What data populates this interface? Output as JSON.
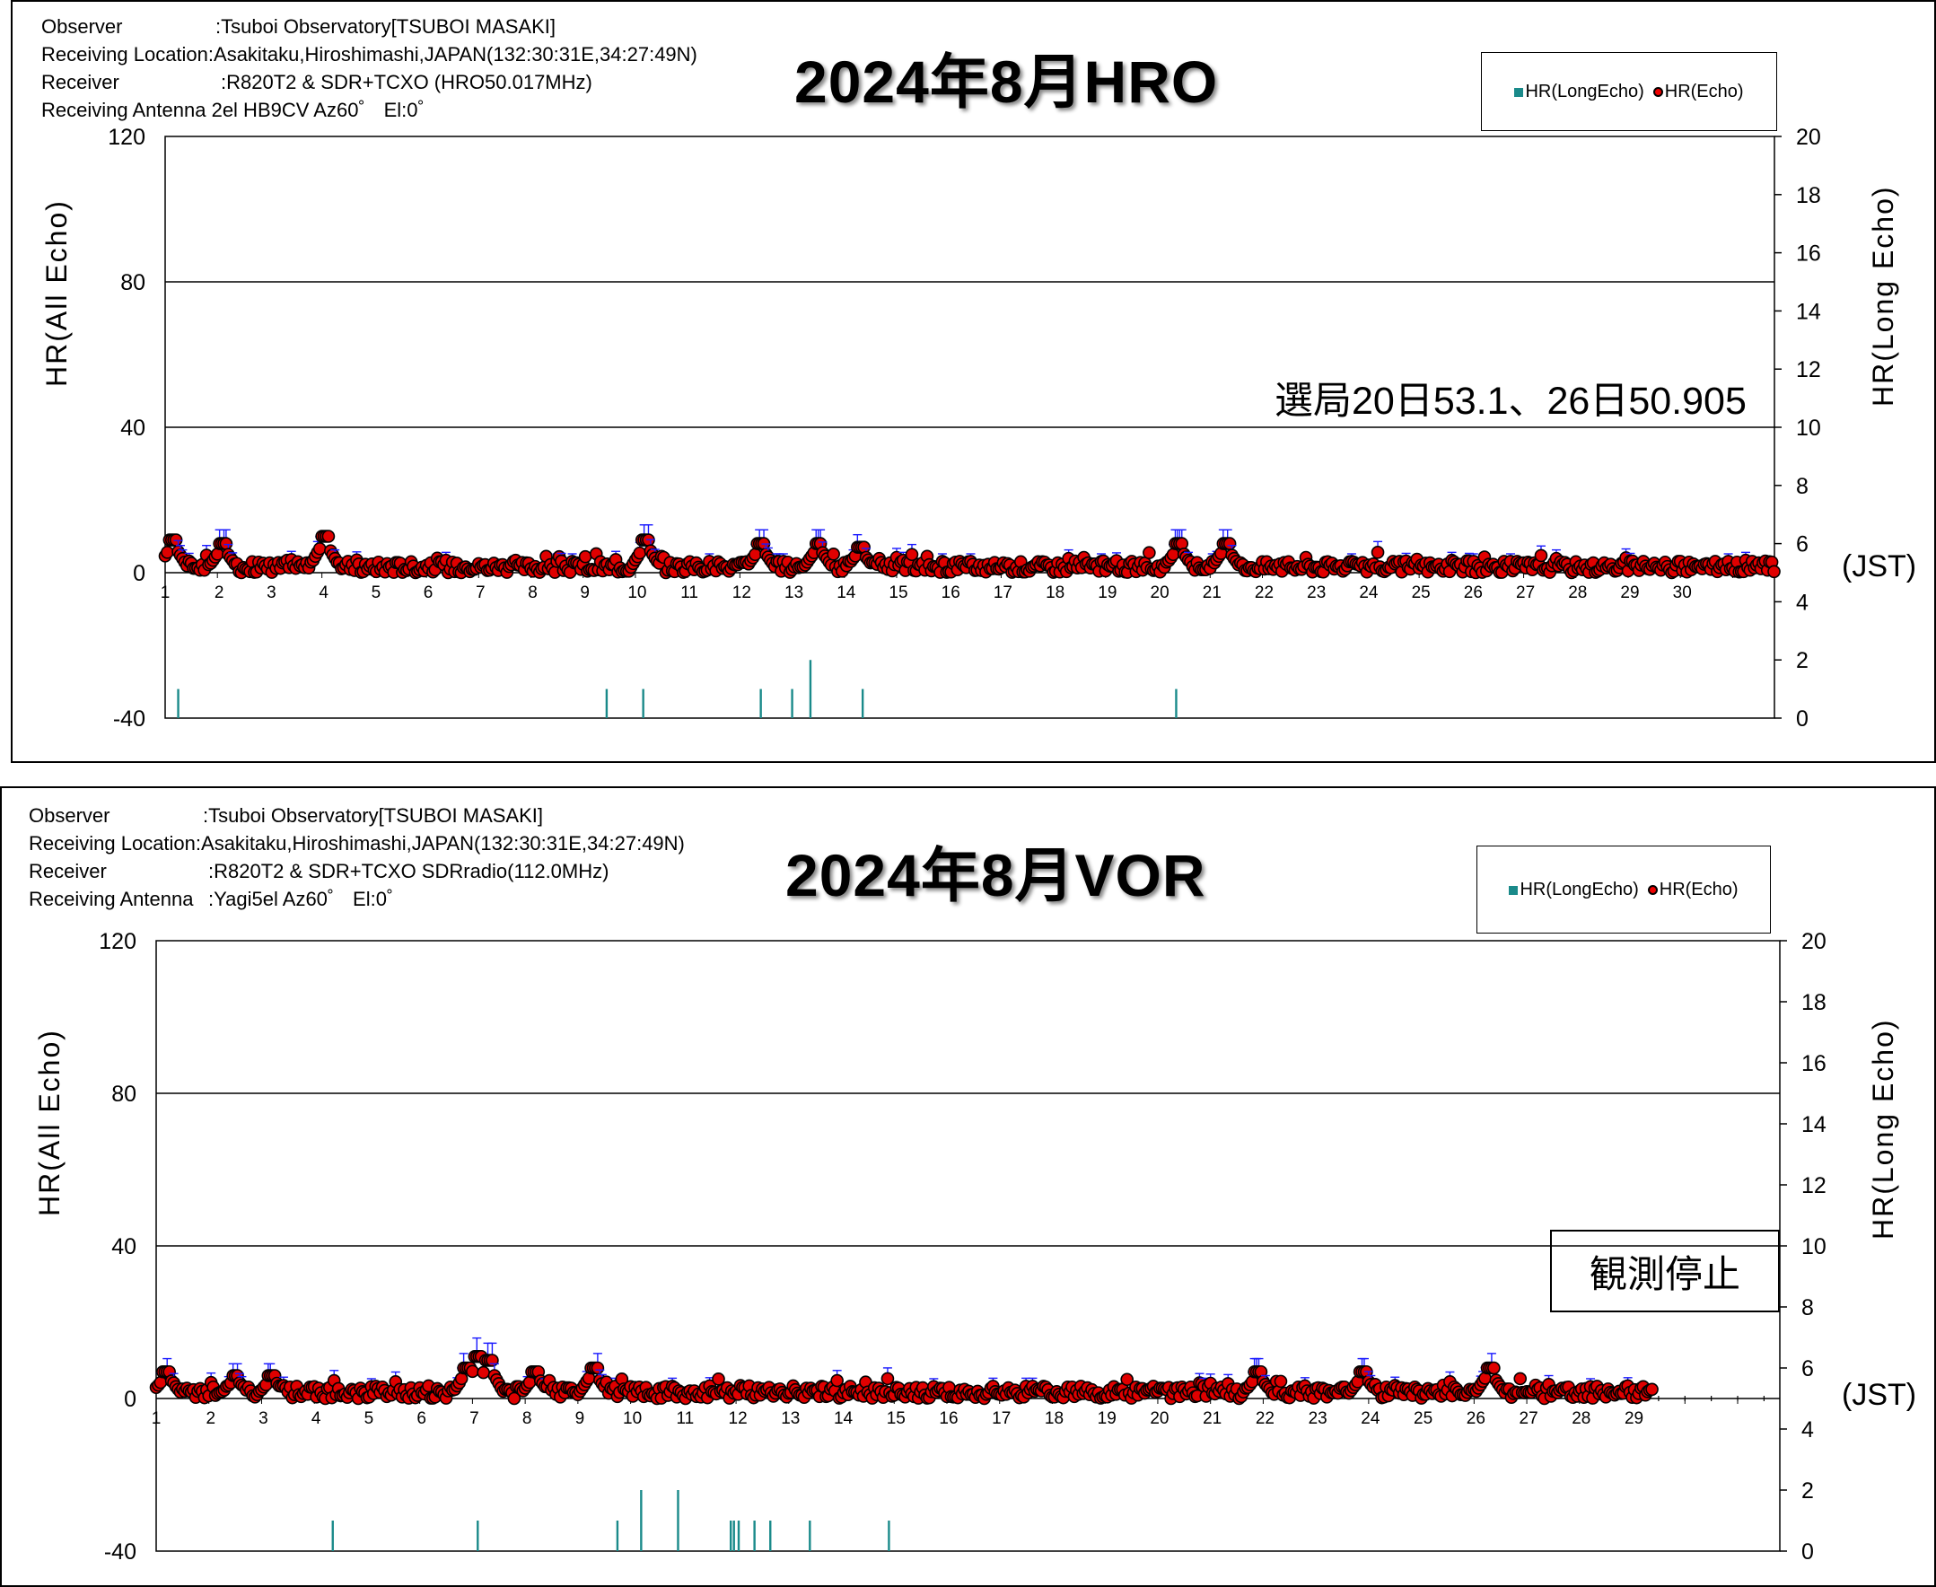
{
  "colors": {
    "echo_fill": "#e00000",
    "echo_edge": "#000000",
    "long_echo": "#1a8a8a",
    "error_bar": "#1a1aff"
  },
  "panels": [
    {
      "info": [
        {
          "k": "Observer",
          "v": ":Tsuboi Observatory[TSUBOI MASAKI]"
        },
        {
          "k": "Receiving Location",
          "v": ":Asakitaku,Hiroshimashi,JAPAN(132:30:31E,34:27:49N)"
        },
        {
          "k": "Receiver",
          "v": ":R820T2 & SDR+TCXO (HRO50.017MHz)"
        },
        {
          "k": "Receiving Antenna",
          "v": " 2el HB9CV Az60゜ El:0゜"
        }
      ],
      "title": "2024年8月HRO",
      "legend": {
        "long": "HR(LongEcho)",
        "echo": "HR(Echo)"
      },
      "ylabel_left": "HR(All Echo)",
      "ylabel_right": "HR(Long Echo)",
      "jst": "(JST)",
      "annotation": "選局20日53.1、26日50.905",
      "stop_label": ""
    },
    {
      "info": [
        {
          "k": "Observer",
          "v": ":Tsuboi Observatory[TSUBOI MASAKI]"
        },
        {
          "k": "Receiving Location",
          "v": ":Asakitaku,Hiroshimashi,JAPAN(132:30:31E,34:27:49N)"
        },
        {
          "k": "Receiver",
          "v": ":R820T2 & SDR+TCXO SDRradio(112.0MHz)"
        },
        {
          "k": "Receiving Antenna",
          "v": ":Yagi5el  Az60゜ El:0゜"
        }
      ],
      "title": "2024年8月VOR",
      "legend": {
        "long": "HR(LongEcho)",
        "echo": "HR(Echo)"
      },
      "ylabel_left": "HR(All Echo)",
      "ylabel_right": "HR(Long Echo)",
      "jst": "(JST)",
      "annotation": "",
      "stop_label": "観測停止"
    }
  ],
  "chart_data": [
    {
      "type": "scatter",
      "title": "2024年8月HRO",
      "x_unit": "day of August 2024 (JST), hourly",
      "x_ticks": [
        "1",
        "2",
        "3",
        "4",
        "5",
        "6",
        "7",
        "8",
        "9",
        "10",
        "11",
        "12",
        "13",
        "14",
        "15",
        "16",
        "17",
        "18",
        "19",
        "20",
        "21",
        "22",
        "23",
        "24",
        "25",
        "26",
        "27",
        "28",
        "29",
        "30"
      ],
      "xlim": [
        1,
        31.8
      ],
      "y_left": {
        "label": "HR(All Echo)",
        "lim": [
          -40,
          120
        ],
        "ticks": [
          -40,
          0,
          40,
          80,
          120
        ]
      },
      "y_right": {
        "label": "HR(Long Echo)",
        "lim": [
          0,
          20
        ],
        "ticks": [
          0,
          2,
          4,
          6,
          8,
          10,
          12,
          14,
          16,
          18,
          20
        ]
      },
      "grid": "horizontal at 40 and 80",
      "legend": "top-right",
      "series": [
        {
          "name": "HR(Echo)",
          "axis": "left",
          "typical_range": [
            0,
            6
          ],
          "peaks": [
            [
              1.15,
              9
            ],
            [
              2.1,
              8
            ],
            [
              4.05,
              10
            ],
            [
              10.2,
              9
            ],
            [
              12.4,
              8
            ],
            [
              13.5,
              8
            ],
            [
              14.3,
              7
            ],
            [
              20.4,
              8
            ],
            [
              21.3,
              8
            ]
          ],
          "end_day": 31.8
        },
        {
          "name": "HR(LongEcho)",
          "axis": "right",
          "points": [
            [
              1.25,
              1
            ],
            [
              9.45,
              1
            ],
            [
              10.15,
              1
            ],
            [
              12.4,
              1
            ],
            [
              13.0,
              1
            ],
            [
              13.35,
              2
            ],
            [
              14.35,
              1
            ],
            [
              20.35,
              1
            ]
          ]
        }
      ]
    },
    {
      "type": "scatter",
      "title": "2024年8月VOR",
      "x_unit": "day of August 2024 (JST), hourly",
      "x_ticks": [
        "1",
        "2",
        "3",
        "4",
        "5",
        "6",
        "7",
        "8",
        "9",
        "10",
        "11",
        "12",
        "13",
        "14",
        "15",
        "16",
        "17",
        "18",
        "19",
        "20",
        "21",
        "22",
        "23",
        "24",
        "25",
        "26",
        "27",
        "28",
        "29"
      ],
      "xlim": [
        1,
        31.8
      ],
      "y_left": {
        "label": "HR(All Echo)",
        "lim": [
          -40,
          120
        ],
        "ticks": [
          -40,
          0,
          40,
          80,
          120
        ]
      },
      "y_right": {
        "label": "HR(Long Echo)",
        "lim": [
          0,
          20
        ],
        "ticks": [
          0,
          2,
          4,
          6,
          8,
          10,
          12,
          14,
          16,
          18,
          20
        ]
      },
      "grid": "horizontal at 40 and 80",
      "legend": "top-right",
      "series": [
        {
          "name": "HR(Echo)",
          "axis": "left",
          "typical_range": [
            0,
            6
          ],
          "peaks": [
            [
              1.2,
              7
            ],
            [
              2.5,
              6
            ],
            [
              3.2,
              6
            ],
            [
              6.9,
              8
            ],
            [
              7.1,
              11
            ],
            [
              7.3,
              10
            ],
            [
              8.2,
              7
            ],
            [
              9.3,
              8
            ],
            [
              21.9,
              7
            ],
            [
              23.9,
              7
            ],
            [
              26.3,
              8
            ]
          ],
          "end_day": 29.4
        },
        {
          "name": "HR(LongEcho)",
          "axis": "right",
          "points": [
            [
              4.35,
              1
            ],
            [
              7.1,
              1
            ],
            [
              9.75,
              1
            ],
            [
              10.2,
              2
            ],
            [
              10.9,
              2
            ],
            [
              11.9,
              1
            ],
            [
              11.96,
              1
            ],
            [
              12.05,
              1
            ],
            [
              12.35,
              1
            ],
            [
              12.65,
              1
            ],
            [
              13.4,
              1
            ],
            [
              14.9,
              1
            ]
          ]
        }
      ]
    }
  ]
}
